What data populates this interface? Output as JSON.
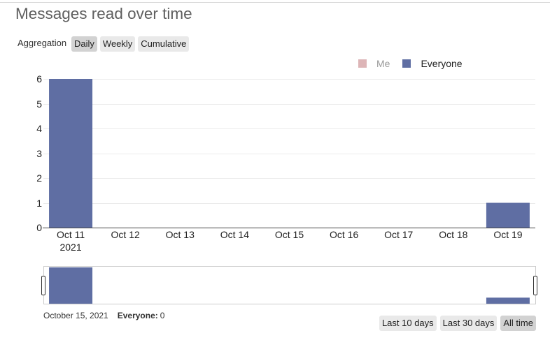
{
  "aggregation": {
    "label": "Aggregation",
    "buttons": [
      {
        "label": "Daily",
        "selected": true
      },
      {
        "label": "Weekly",
        "selected": false
      },
      {
        "label": "Cumulative",
        "selected": false
      }
    ]
  },
  "chart_data": {
    "type": "bar",
    "title": "Messages read over time",
    "categories": [
      "Oct 11",
      "Oct 12",
      "Oct 13",
      "Oct 14",
      "Oct 15",
      "Oct 16",
      "Oct 17",
      "Oct 18",
      "Oct 19"
    ],
    "x_tick_year": "2021",
    "series": [
      {
        "name": "Me",
        "color": "#ddb5b7",
        "visible": false
      },
      {
        "name": "Everyone",
        "color": "#5f6ea3",
        "visible": true,
        "values": [
          6,
          0,
          0,
          0,
          0,
          0,
          0,
          0,
          1
        ]
      }
    ],
    "y_ticks": [
      0,
      1,
      2,
      3,
      4,
      5,
      6
    ],
    "ylim": [
      0,
      6
    ],
    "grid": true,
    "legend_position": "top-right",
    "range_slider": true
  },
  "hover_info": {
    "date": "October 15, 2021",
    "series_label": "Everyone:",
    "value": "0"
  },
  "time_range": {
    "buttons": [
      {
        "label": "Last 10 days",
        "selected": false
      },
      {
        "label": "Last 30 days",
        "selected": false
      },
      {
        "label": "All time",
        "selected": true
      }
    ]
  }
}
